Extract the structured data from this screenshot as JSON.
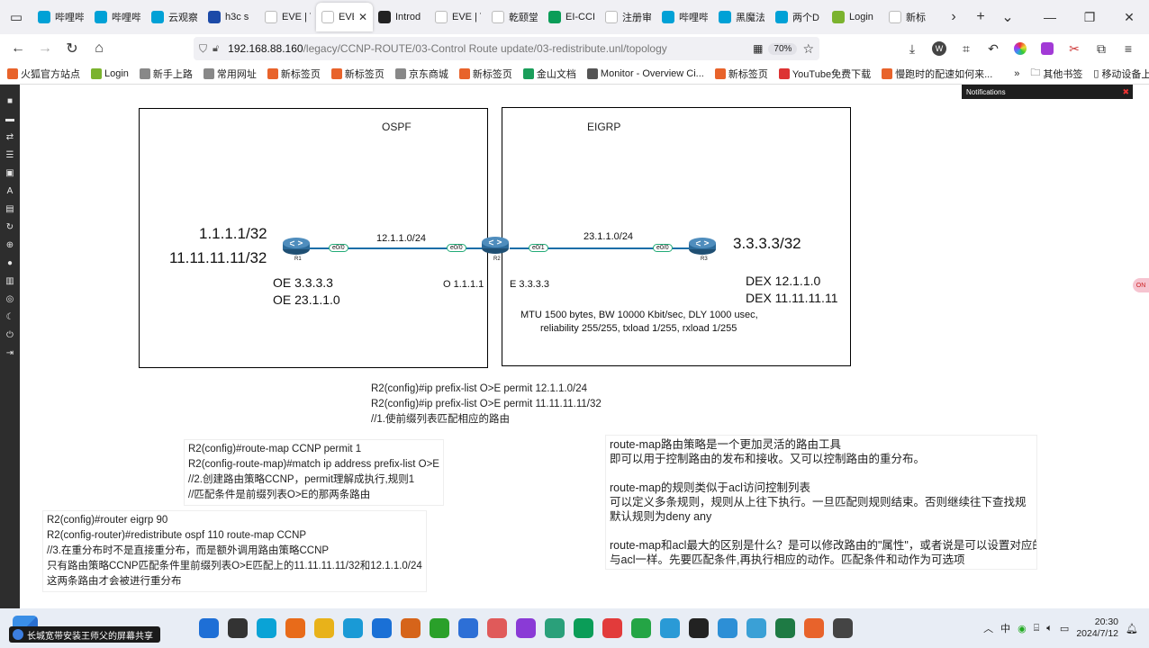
{
  "browser": {
    "tabs": [
      {
        "label": "哔哩哔",
        "color": "#00a1d6"
      },
      {
        "label": "哔哩哔",
        "color": "#00a1d6"
      },
      {
        "label": "云观察",
        "color": "#00a1d6"
      },
      {
        "label": "h3c s",
        "color": "#1c4aa8"
      },
      {
        "label": "EVE | Top",
        "color": "#ffffff"
      },
      {
        "label": "EVE | To",
        "color": "#ffffff",
        "active": true
      },
      {
        "label": "Introd",
        "color": "#222222"
      },
      {
        "label": "EVE | Top",
        "color": "#ffffff"
      },
      {
        "label": "乾颐堂H",
        "color": "#ffffff"
      },
      {
        "label": "EI-CCI",
        "color": "#0b9d58"
      },
      {
        "label": "注册审批",
        "color": "#ffffff"
      },
      {
        "label": "哔哩哔",
        "color": "#00a1d6"
      },
      {
        "label": "黑魔法",
        "color": "#00a1d6"
      },
      {
        "label": "两个D",
        "color": "#00a1d6"
      },
      {
        "label": "Login",
        "color": "#7bb32e"
      },
      {
        "label": "新标",
        "color": "#ffffff"
      }
    ],
    "url_host": "192.168.88.160",
    "url_path": "/legacy/CCNP-ROUTE/03-Control Route update/03-redistribute.unl/topology",
    "zoom": "70%",
    "bookmarks": [
      {
        "label": "火狐官方站点",
        "color": "#e8632b"
      },
      {
        "label": "Login",
        "color": "#7bb32e"
      },
      {
        "label": "新手上路",
        "color": "#888888"
      },
      {
        "label": "常用网址",
        "color": "#888888"
      },
      {
        "label": "新标签页",
        "color": "#e8632b"
      },
      {
        "label": "新标签页",
        "color": "#e8632b"
      },
      {
        "label": "京东商城",
        "color": "#888888"
      },
      {
        "label": "新标签页",
        "color": "#e8632b"
      },
      {
        "label": "金山文档",
        "color": "#1a9e5a"
      },
      {
        "label": "Monitor - Overview Ci...",
        "color": "#555555"
      },
      {
        "label": "新标签页",
        "color": "#e8632b"
      },
      {
        "label": "YouTube免费下载",
        "color": "#d33"
      },
      {
        "label": "慢跑时的配速如何来...",
        "color": "#e8632b"
      }
    ],
    "other_bookmarks": "其他书签",
    "mobile_bookmarks": "移动设备上的书签"
  },
  "notifications": "Notifications",
  "side_tab": "ON",
  "topology": {
    "zones": [
      {
        "name": "OSPF"
      },
      {
        "name": "EIGRP"
      }
    ],
    "routers": [
      {
        "name": "R1"
      },
      {
        "name": "R2"
      },
      {
        "name": "R3"
      }
    ],
    "interfaces": [
      "e0/0",
      "e0/0",
      "e0/1",
      "e0/0"
    ],
    "networks": [
      "12.1.1.0/24",
      "23.1.1.0/24"
    ],
    "r1_loopbacks": [
      "1.1.1.1/32",
      "11.11.11.11/32"
    ],
    "r1_routes": [
      "OE 3.3.3.3",
      "OE 23.1.1.0"
    ],
    "r2_ospf_route": "O 1.1.1.1",
    "r2_eigrp_route": "E  3.3.3.3",
    "r3_loopback": "3.3.3.3/32",
    "r3_routes": [
      "DEX 12.1.1.0",
      "DEX 11.11.11.11"
    ],
    "metric_line1": "MTU 1500 bytes, BW 10000 Kbit/sec, DLY 1000 usec,",
    "metric_line2": "reliability 255/255, txload 1/255, rxload 1/255"
  },
  "config_notes": {
    "prefix_list": [
      "R2(config)#ip prefix-list O>E permit 12.1.1.0/24",
      "R2(config)#ip prefix-list O>E permit 11.11.11.11/32",
      "//1.使前缀列表匹配相应的路由"
    ],
    "route_map": [
      "R2(config)#route-map CCNP permit 1",
      "R2(config-route-map)#match ip address prefix-list O>E",
      "//2.创建路由策略CCNP，permit理解成执行,规则1",
      "//匹配条件是前缀列表O>E的那两条路由"
    ],
    "redistribute": [
      "R2(config)#router eigrp 90",
      "R2(config-router)#redistribute ospf 110 route-map CCNP",
      "//3.在重分布时不是直接重分布，而是额外调用路由策略CCNP",
      "只有路由策略CCNP匹配条件里前缀列表O>E匹配上的11.11.11.11/32和12.1.1.0/24",
      "这两条路由才会被进行重分布"
    ],
    "explanation": [
      "route-map路由策略是一个更加灵活的路由工具",
      "即可以用于控制路由的发布和接收。又可以控制路由的重分布。",
      "",
      "route-map的规则类似于acl访问控制列表",
      "可以定义多条规则，规则从上往下执行。一旦匹配则规则结束。否则继续往下查找规",
      "默认规则为deny any",
      "",
      "route-map和acl最大的区别是什么？是可以修改路由的\"属性\"，或者说是可以设置对应的",
      "与acl一样。先要匹配条件,再执行相应的动作。匹配条件和动作为可选项"
    ]
  },
  "taskbar": {
    "share_text": "长城宽带安装王师父的屏幕共享",
    "time": "20:30",
    "date": "2024/7/12",
    "ime": "中",
    "apps": [
      "#1e6fd6",
      "#333333",
      "#0aa3d6",
      "#e86b1a",
      "#e8b21a",
      "#1a9ad6",
      "#1a70d6",
      "#d6641a",
      "#2aa02a",
      "#2d6fd6",
      "#e05a5a",
      "#8a3ad6",
      "#2aa07a",
      "#0b9d58",
      "#e23b3b",
      "#24a545",
      "#2a9ad6",
      "#222222",
      "#2d8fd6",
      "#3aa0d6",
      "#1e7a44",
      "#e8632b",
      "#444444"
    ]
  }
}
